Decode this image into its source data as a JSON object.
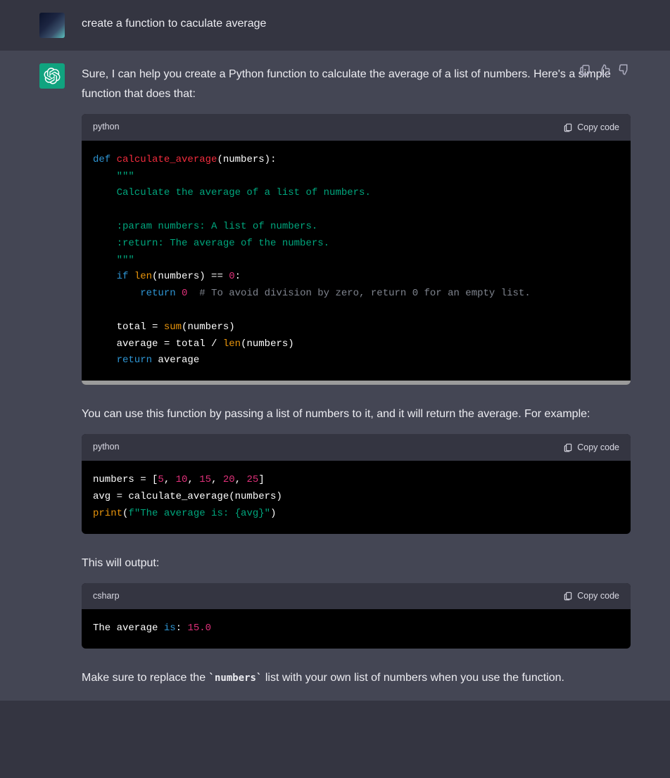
{
  "user": {
    "text": "create a function to caculate average"
  },
  "assistant": {
    "intro": "Sure, I can help you create a Python function to calculate the average of a list of numbers. Here's a simple function that does that:",
    "usage": "You can use this function by passing a list of numbers to it, and it will return the average. For example:",
    "output_lead": "This will output:",
    "closing_a": "Make sure to replace the ",
    "closing_code": "`numbers`",
    "closing_b": " list with your own list of numbers when you use the function."
  },
  "code1": {
    "lang": "python",
    "copy": "Copy code",
    "l1_def": "def",
    "l1_name": " calculate_average",
    "l1_rest": "(numbers):",
    "l2": "    \"\"\"",
    "l3": "    Calculate the average of a list of numbers.",
    "l4": "",
    "l5": "    :param numbers: A list of numbers.",
    "l6": "    :return: The average of the numbers.",
    "l7": "    \"\"\"",
    "l8_if": "    if",
    "l8_len": " len",
    "l8_mid": "(numbers) == ",
    "l8_zero": "0",
    "l8_colon": ":",
    "l9_ret": "        return",
    "l9_sp": " ",
    "l9_zero": "0",
    "l9_sp2": "  ",
    "l9_cm": "# To avoid division by zero, return 0 for an empty list.",
    "l10": "",
    "l11_a": "    total = ",
    "l11_sum": "sum",
    "l11_b": "(numbers)",
    "l12_a": "    average = total / ",
    "l12_len": "len",
    "l12_b": "(numbers)",
    "l13_ret": "    return",
    "l13_b": " average"
  },
  "code2": {
    "lang": "python",
    "copy": "Copy code",
    "l1_a": "numbers = [",
    "l1_n1": "5",
    "l1_c1": ", ",
    "l1_n2": "10",
    "l1_c2": ", ",
    "l1_n3": "15",
    "l1_c3": ", ",
    "l1_n4": "20",
    "l1_c4": ", ",
    "l1_n5": "25",
    "l1_b": "]",
    "l2": "avg = calculate_average(numbers)",
    "l3_print": "print",
    "l3_paren": "(",
    "l3_f": "f\"The average is: ",
    "l3_br": "{avg}",
    "l3_end": "\"",
    "l3_close": ")"
  },
  "code3": {
    "lang": "csharp",
    "copy": "Copy code",
    "l1_a": "The average ",
    "l1_is": "is",
    "l1_b": ": ",
    "l1_num": "15.0"
  }
}
